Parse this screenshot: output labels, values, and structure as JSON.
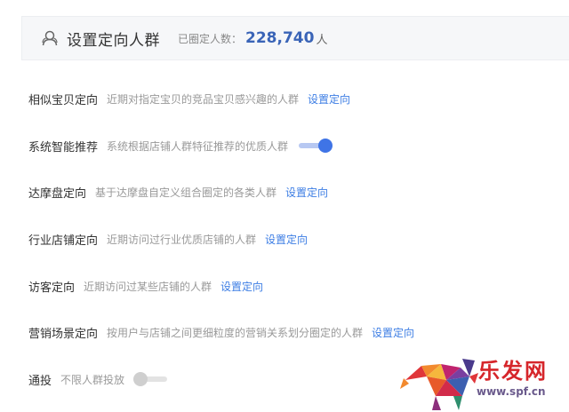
{
  "header": {
    "title": "设置定向人群",
    "count_label": "已圈定人数：",
    "count_value": "228,740",
    "count_unit": "人",
    "icon": "crowd-icon"
  },
  "rows": [
    {
      "label": "相似宝贝定向",
      "desc": "近期对指定宝贝的竞品宝贝感兴趣的人群",
      "link": "设置定向"
    },
    {
      "label": "系统智能推荐",
      "desc": "系统根据店铺人群特征推荐的优质人群",
      "toggle": "on"
    },
    {
      "label": "达摩盘定向",
      "desc": "基于达摩盘自定义组合圈定的各类人群",
      "link": "设置定向"
    },
    {
      "label": "行业店铺定向",
      "desc": "近期访问过行业优质店铺的人群",
      "link": "设置定向"
    },
    {
      "label": "访客定向",
      "desc": "近期访问过某些店铺的人群",
      "link": "设置定向"
    },
    {
      "label": "营销场景定向",
      "desc": "按用户与店铺之间更细粒度的营销关系划分圈定的人群",
      "link": "设置定向"
    },
    {
      "label": "通投",
      "desc": "不限人群投放",
      "toggle": "off"
    }
  ],
  "watermark": {
    "brand": "乐发网",
    "url": "www.spf.cn"
  },
  "colors": {
    "accent": "#3f74e6",
    "link": "#3d7ee4",
    "count": "#3a64b7",
    "brand": "#d6262b"
  }
}
